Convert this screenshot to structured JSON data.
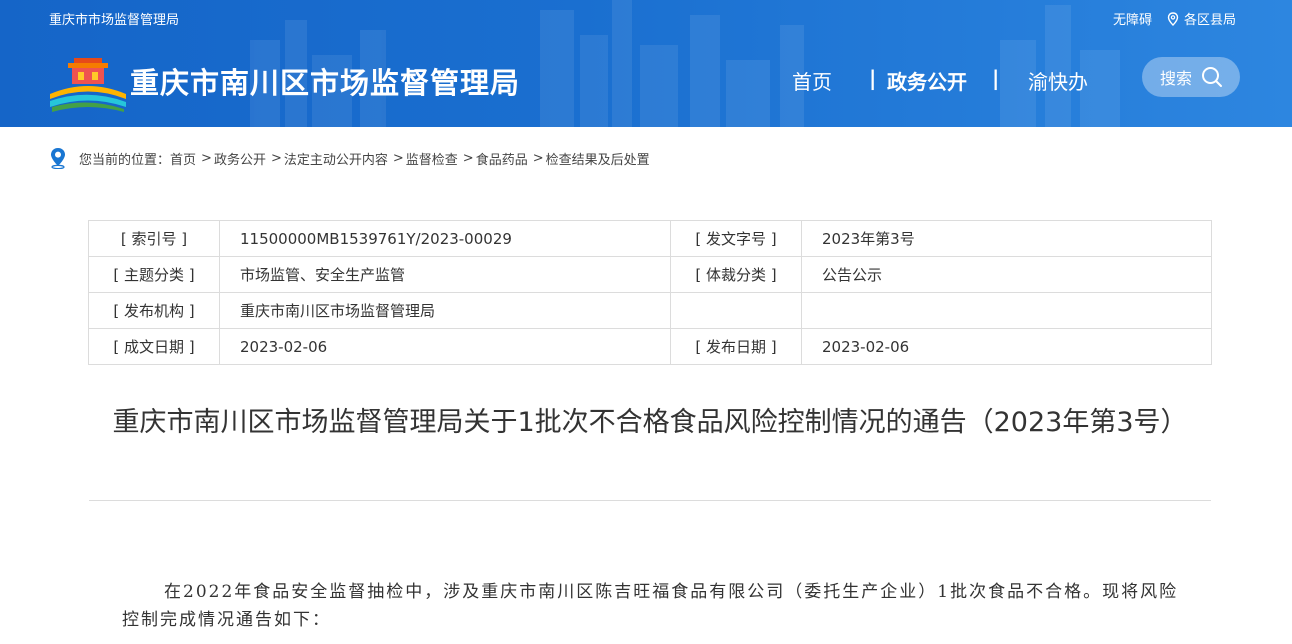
{
  "header": {
    "org_name": "重庆市市场监督管理局",
    "accessibility": "无障碍",
    "districts": "各区县局",
    "site_title": "重庆市南川区市场监督管理局",
    "nav": {
      "home": "首页",
      "sep1": "|",
      "gov": "政务公开",
      "sep2": "|",
      "yu": "渝快办"
    },
    "search_label": "搜索"
  },
  "breadcrumb": {
    "prefix": "您当前的位置：",
    "items": [
      "首页",
      "政务公开",
      "法定主动公开内容",
      "监督检查",
      "食品药品",
      "检查结果及后处置"
    ],
    "separator": ">"
  },
  "meta": {
    "rows": [
      {
        "k1": "[ 索引号 ]",
        "v1": "11500000MB1539761Y/2023-00029",
        "k2": "[ 发文字号 ]",
        "v2": "2023年第3号"
      },
      {
        "k1": "[ 主题分类 ]",
        "v1": "市场监管、安全生产监管",
        "k2": "[ 体裁分类 ]",
        "v2": "公告公示"
      },
      {
        "k1": "[ 发布机构 ]",
        "v1": "重庆市南川区市场监督管理局",
        "k2": "",
        "v2": ""
      },
      {
        "k1": "[ 成文日期 ]",
        "v1": "2023-02-06",
        "k2": "[ 发布日期 ]",
        "v2": "2023-02-06"
      }
    ]
  },
  "document": {
    "title": "重庆市南川区市场监督管理局关于1批次不合格食品风险控制情况的通告（2023年第3号）",
    "paragraph": "在2022年食品安全监督抽检中，涉及重庆市南川区陈吉旺福食品有限公司（委托生产企业）1批次食品不合格。现将风险控制完成情况通告如下："
  },
  "colors": {
    "header_blue": "#1a6fd0",
    "border": "#dcdcdc",
    "text": "#333333"
  },
  "icons": [
    "location-pin-icon",
    "search-icon",
    "map-pin-icon",
    "tiananmen-logo-icon"
  ]
}
